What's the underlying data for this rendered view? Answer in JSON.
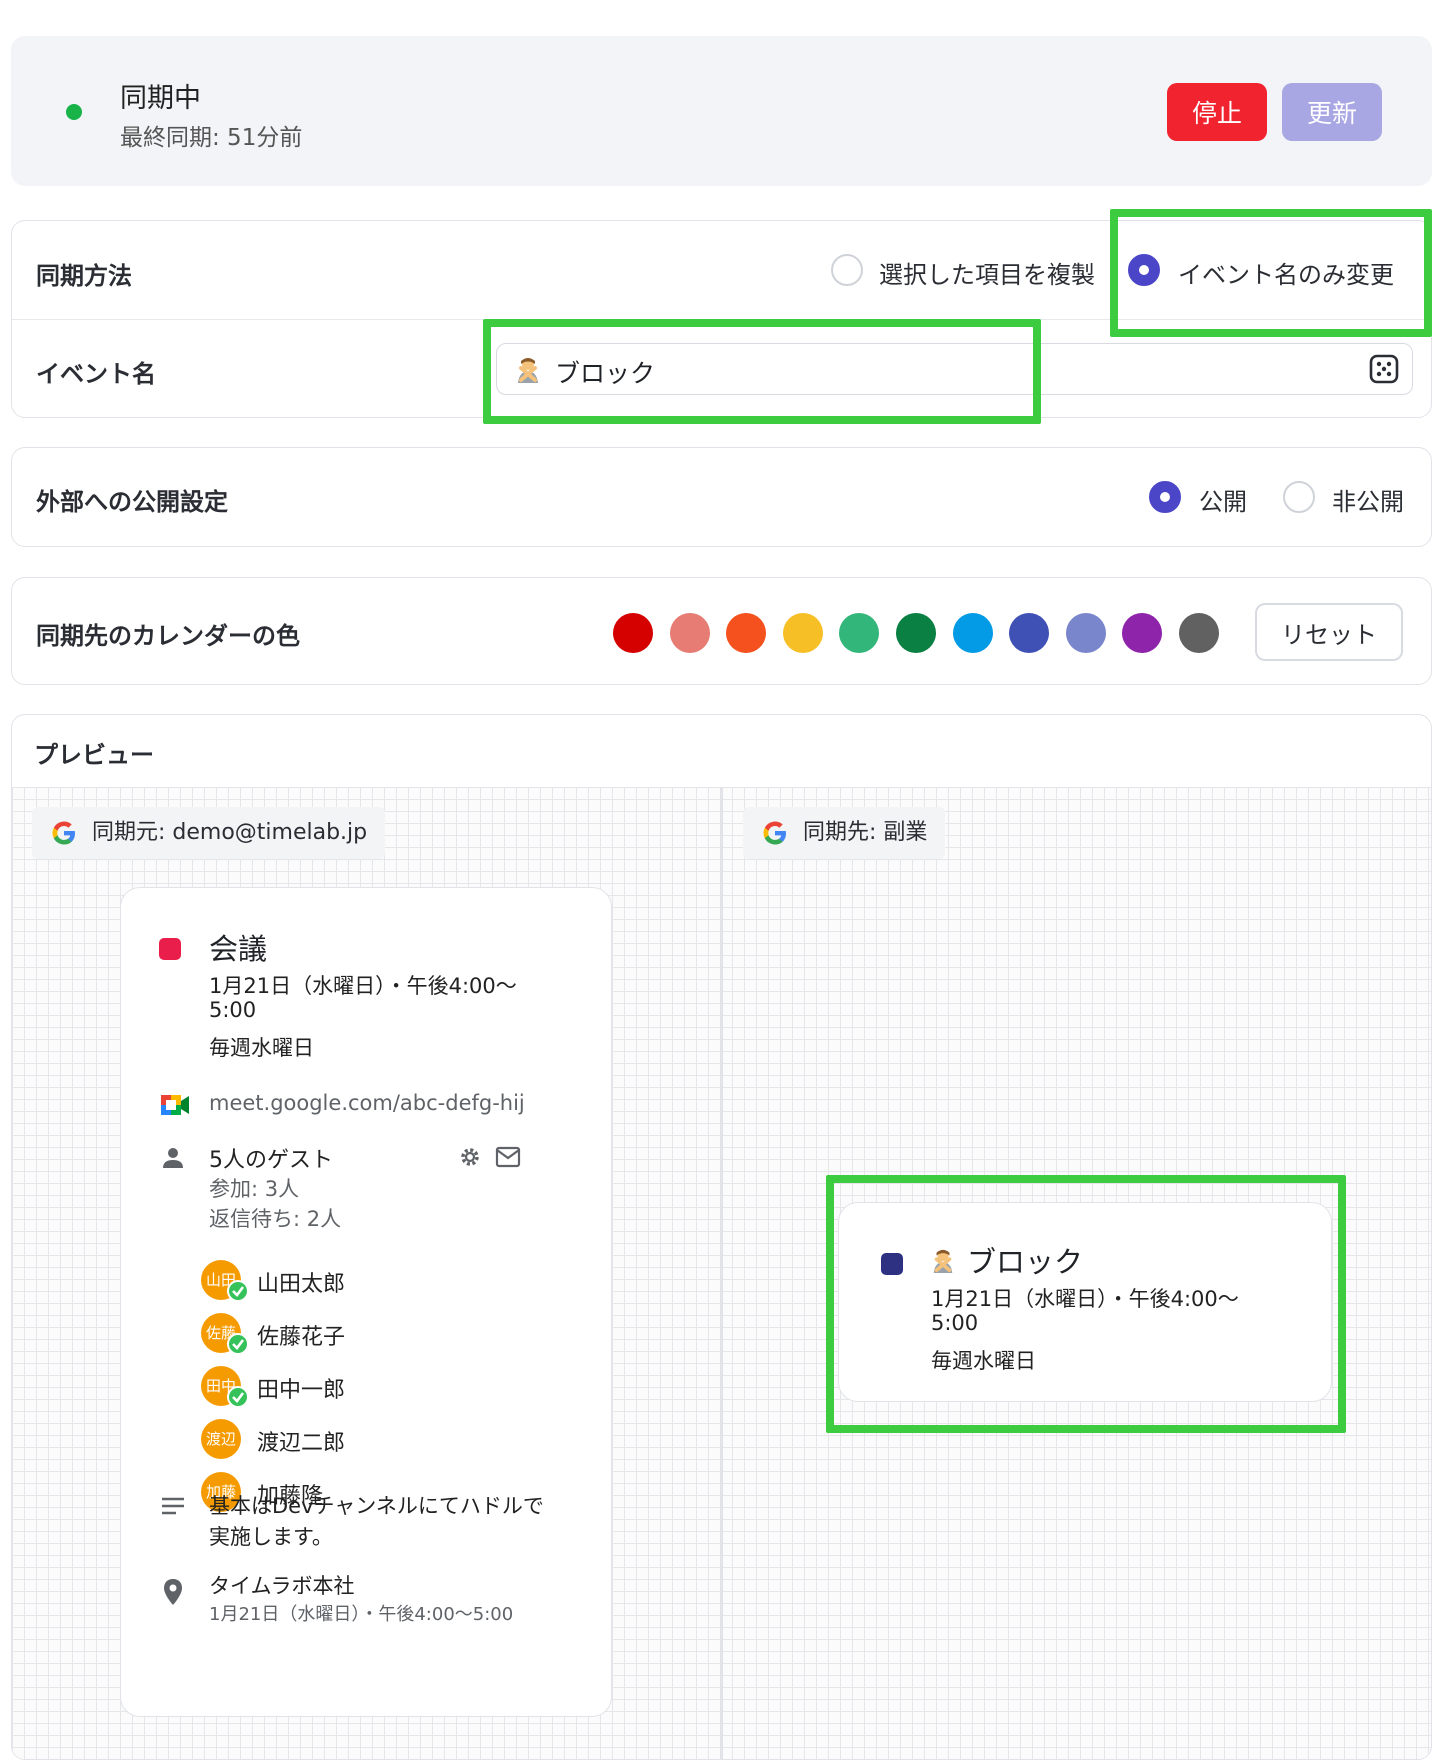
{
  "status": {
    "title": "同期中",
    "last_sync": "最終同期: 51分前",
    "stop_label": "停止",
    "refresh_label": "更新",
    "dot_color": "#18b449"
  },
  "sync_method": {
    "label": "同期方法",
    "options": [
      "選択した項目を複製",
      "イベント名のみ変更"
    ],
    "selected": "イベント名のみ変更"
  },
  "event_name": {
    "label": "イベント名",
    "value": "ブロック",
    "emoji_icon": "person-gesturing-no-icon"
  },
  "visibility": {
    "label": "外部への公開設定",
    "options": [
      "公開",
      "非公開"
    ],
    "selected": "公開"
  },
  "calendar_color": {
    "label": "同期先のカレンダーの色",
    "colors": [
      "#d50000",
      "#e67c73",
      "#f4511e",
      "#f6bf26",
      "#33b679",
      "#0b8043",
      "#039be5",
      "#3f51b5",
      "#7986cb",
      "#8e24aa",
      "#616161"
    ],
    "reset_label": "リセット"
  },
  "preview": {
    "title": "プレビュー",
    "source": {
      "tag": "同期元: demo@timelab.jp",
      "event": {
        "color": "#e91e4a",
        "title": "会議",
        "time_line1": "1月21日（水曜日）・午後4:00〜",
        "time_line2": "5:00",
        "repeat": "毎週水曜日",
        "meet_link": "meet.google.com/abc-defg-hij",
        "guests_title": "5人のゲスト",
        "guests_joined": "参加: 3人",
        "guests_pending": "返信待ち: 2人",
        "guests": [
          {
            "avatar": "山田",
            "name": "山田太郎",
            "confirmed": true
          },
          {
            "avatar": "佐藤",
            "name": "佐藤花子",
            "confirmed": true
          },
          {
            "avatar": "田中",
            "name": "田中一郎",
            "confirmed": true
          },
          {
            "avatar": "渡辺",
            "name": "渡辺二郎",
            "confirmed": false
          },
          {
            "avatar": "加藤",
            "name": "加藤隆",
            "confirmed": false
          }
        ],
        "description_line1": "基本はDevチャンネルにてハドルで",
        "description_line2": "実施します。",
        "location": "タイムラボ本社",
        "location_time": "1月21日（水曜日）・午後4:00〜5:00"
      }
    },
    "target": {
      "tag": "同期先: 副業",
      "event": {
        "color": "#2e3182",
        "title": "ブロック",
        "time_line1": "1月21日（水曜日）・午後4:00〜",
        "time_line2": "5:00",
        "repeat": "毎週水曜日"
      }
    }
  }
}
